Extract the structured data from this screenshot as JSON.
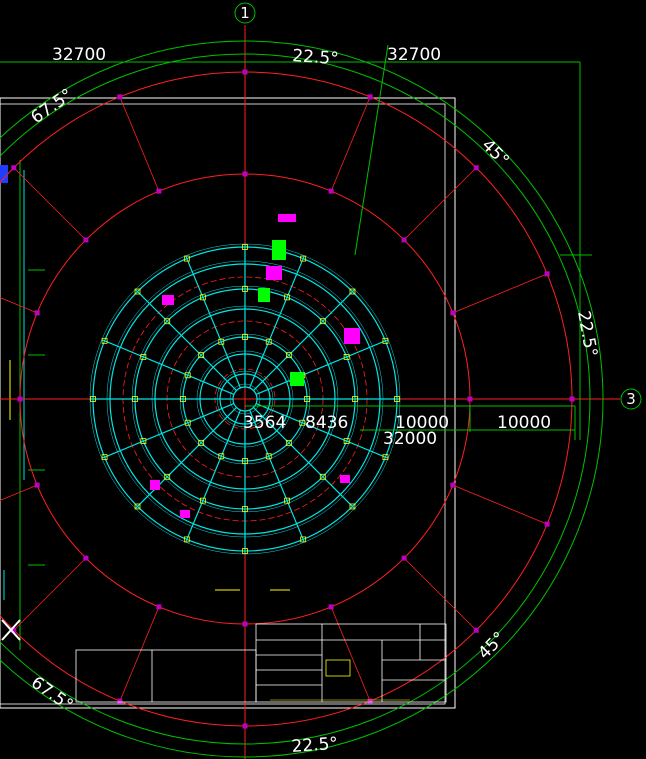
{
  "drawing": {
    "axis_markers": [
      {
        "id": "1",
        "label": "1"
      },
      {
        "id": "3",
        "label": "3"
      }
    ],
    "dimensions": {
      "top_left_span": "32700",
      "top_right_span": "32700",
      "angle_top": "22.5°",
      "angle_top_left": "67.5°",
      "angle_right_upper": "45°",
      "angle_right": "22.5°",
      "angle_right_lower": "45°",
      "angle_bottom_left": "67.5°",
      "angle_bottom": "22.5°",
      "radial_inner": "3564",
      "radial_second": "8436",
      "radial_third": "10000",
      "radial_outer": "10000",
      "radius_total": "32000"
    },
    "title_block": {
      "present": true
    },
    "colors": {
      "background": "#000000",
      "frame": "#ffffff",
      "ring_outer": "#00c000",
      "ring_red": "#ff2020",
      "grid_cyan": "#00e5e5",
      "nodes": "#c000c0",
      "annotation_magenta": "#ff00ff",
      "annotation_green": "#00ff00",
      "annotation_yellow": "#ffff00"
    }
  }
}
